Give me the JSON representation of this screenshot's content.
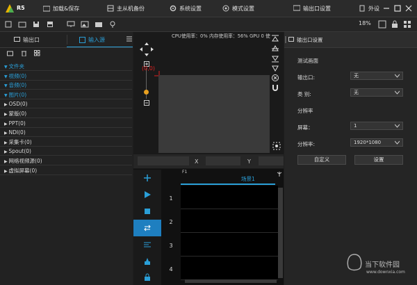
{
  "app": {
    "logo_text": "R5"
  },
  "menu": [
    {
      "label": "加载&保存",
      "icon": "folder-icon"
    },
    {
      "label": "主从机备份",
      "icon": "backup-icon"
    },
    {
      "label": "系统设置",
      "icon": "gear-icon"
    },
    {
      "label": "模式设置",
      "icon": "mode-icon"
    },
    {
      "label": "输出口设置",
      "icon": "output-icon"
    },
    {
      "label": "外设",
      "icon": "peripheral-icon"
    }
  ],
  "toolbar": {
    "zoom": "18%"
  },
  "left_tabs": [
    {
      "label": "输出口"
    },
    {
      "label": "输入源"
    }
  ],
  "tree": [
    {
      "label": "文件夹",
      "style": "blue"
    },
    {
      "label": "视频(0)",
      "style": "blue"
    },
    {
      "label": "音频(0)",
      "style": "blue"
    },
    {
      "label": "图片(0)",
      "style": "blue"
    },
    {
      "label": "OSD(0)",
      "style": "white"
    },
    {
      "label": "蒙版(0)",
      "style": "white"
    },
    {
      "label": "PPT(0)",
      "style": "white"
    },
    {
      "label": "NDI(0)",
      "style": "white"
    },
    {
      "label": "采集卡(0)",
      "style": "white"
    },
    {
      "label": "Spout(0)",
      "style": "white"
    },
    {
      "label": "网络视频源(0)",
      "style": "white"
    },
    {
      "label": "虚拟屏幕(0)",
      "style": "white"
    }
  ],
  "status_text": "CPU使用率：0%   内存使用率：56%   GPU 0 使",
  "coord_label": "(0,0)",
  "xy_labels": {
    "x": "X",
    "y": "Y"
  },
  "right_panel": {
    "title": "输出口设置",
    "test_label": "测试画面",
    "output_label": "输出口:",
    "output_value": "无",
    "category_label": "类 别:",
    "category_value": "无",
    "resolution_label": "分辨率",
    "screen_label": "屏幕：",
    "screen_value": "1",
    "res_label": "分辨率:",
    "res_value": "1920*1080",
    "custom_btn": "自定义",
    "settings_btn": "设置"
  },
  "scene": {
    "f1": "F1",
    "tab": "场景1",
    "rows": [
      "1",
      "2",
      "3",
      "4"
    ]
  },
  "watermark": {
    "text": "当下软件园",
    "url": "www.downxia.com"
  }
}
